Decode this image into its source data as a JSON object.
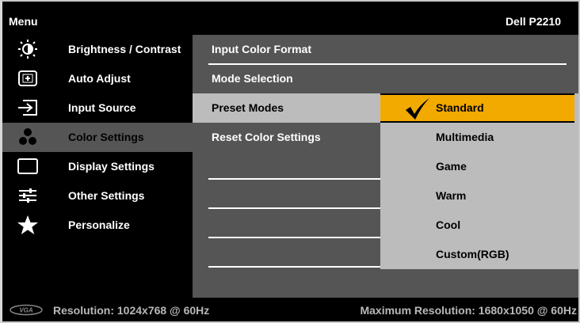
{
  "header": {
    "title": "Menu",
    "model": "Dell P2210"
  },
  "nav": {
    "items": [
      {
        "label": "Brightness / Contrast",
        "icon": "brightness-icon"
      },
      {
        "label": "Auto Adjust",
        "icon": "auto-adjust-icon"
      },
      {
        "label": "Input Source",
        "icon": "input-source-icon"
      },
      {
        "label": "Color Settings",
        "icon": "color-settings-icon",
        "active": true
      },
      {
        "label": "Display Settings",
        "icon": "display-settings-icon"
      },
      {
        "label": "Other Settings",
        "icon": "other-settings-icon"
      },
      {
        "label": "Personalize",
        "icon": "star-icon"
      }
    ]
  },
  "color_settings": {
    "items": [
      {
        "label": "Input Color Format"
      },
      {
        "label": "Mode Selection"
      },
      {
        "label": "Preset Modes",
        "active": true
      },
      {
        "label": "Reset Color Settings"
      }
    ]
  },
  "preset_modes": {
    "options": [
      "Standard",
      "Multimedia",
      "Game",
      "Warm",
      "Cool",
      "Custom(RGB)"
    ],
    "selected": "Standard"
  },
  "footer": {
    "connector_icon": "vga-icon",
    "resolution": "Resolution: 1024x768 @ 60Hz",
    "max_resolution": "Maximum Resolution: 1680x1050 @ 60Hz"
  },
  "colors": {
    "highlight": "#f2a900",
    "panel": "#555555",
    "selected_row": "#bcbcbc"
  }
}
